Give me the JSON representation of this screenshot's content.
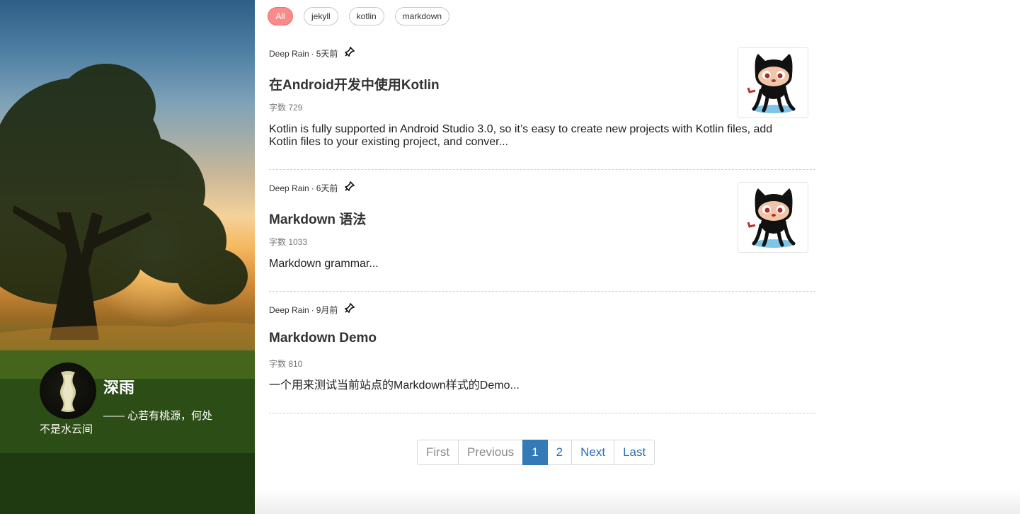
{
  "sidebar": {
    "name": "深雨",
    "motto": "—— 心若有桃源，何处不是水云间"
  },
  "tags": [
    {
      "label": "All",
      "active": true
    },
    {
      "label": "jekyll",
      "active": false
    },
    {
      "label": "kotlin",
      "active": false
    },
    {
      "label": "markdown",
      "active": false
    }
  ],
  "posts": [
    {
      "author": "Deep Rain",
      "time": "5天前",
      "title": "在Android开发中使用Kotlin",
      "words": "字数 729",
      "excerpt": "Kotlin is fully supported in Android Studio 3.0, so it’s easy to create new projects with Kotlin files, add Kotlin files to your existing project, and conver...",
      "thumbnail": "octocat-icon"
    },
    {
      "author": "Deep Rain",
      "time": "6天前",
      "title": "Markdown 语法",
      "words": "字数 1033",
      "excerpt": "Markdown grammar...",
      "thumbnail": "octocat-icon"
    },
    {
      "author": "Deep Rain",
      "time": "9月前",
      "title": "Markdown Demo",
      "words": "字数 810",
      "excerpt": "一个用来测试当前站点的Markdown样式的Demo..."
    }
  ],
  "meta_separator": "·",
  "pagination": {
    "first": "First",
    "previous": "Previous",
    "pages": [
      "1",
      "2"
    ],
    "current": "1",
    "next": "Next",
    "last": "Last"
  },
  "colors": {
    "tag_active": "#f98b8b",
    "page_active": "#337ab7",
    "link": "#2a6fb8"
  }
}
